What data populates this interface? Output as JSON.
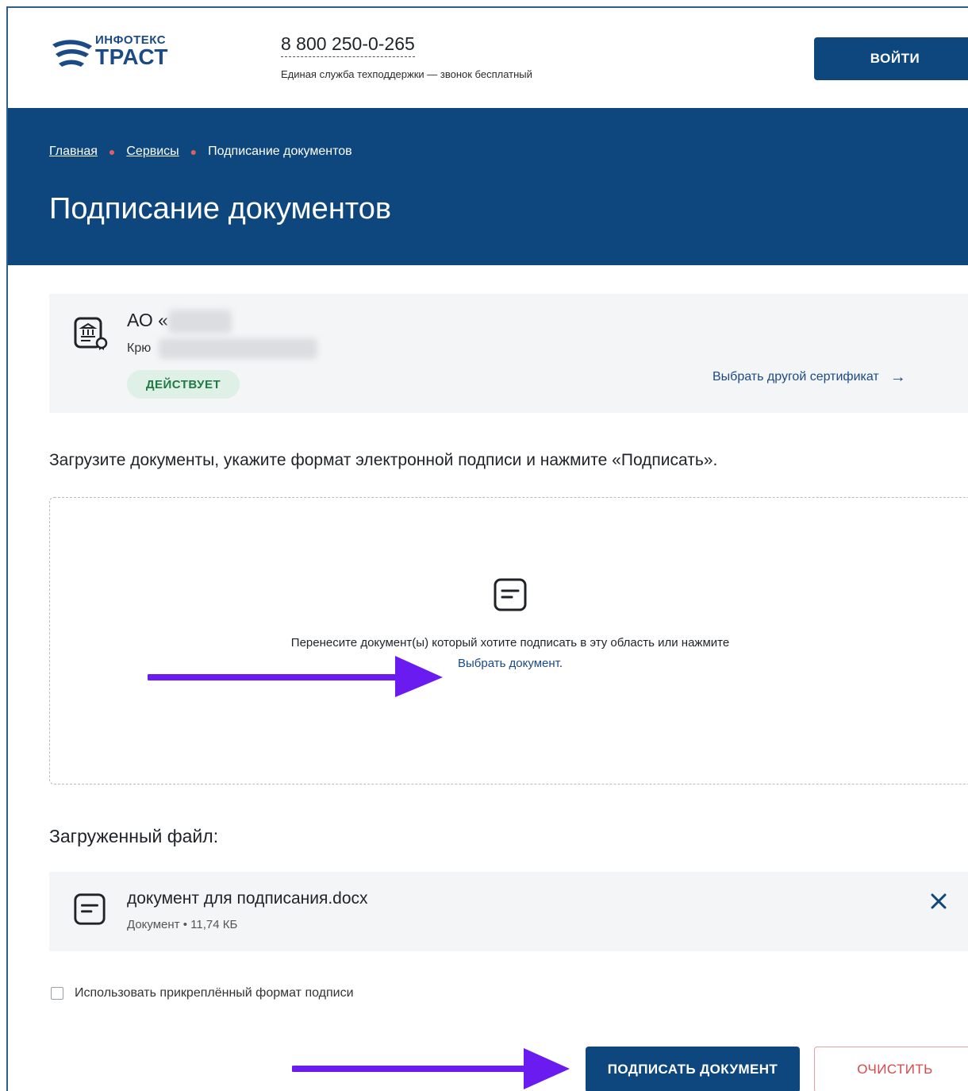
{
  "header": {
    "logo_top": "ИНФОТЕКС",
    "logo_main": "ТРАСТ",
    "phone": "8 800 250-0-265",
    "phone_caption": "Единая служба техподдержки — звонок бесплатный",
    "login_label": "ВОЙТИ"
  },
  "breadcrumb": {
    "items": [
      "Главная",
      "Сервисы"
    ],
    "current": "Подписание документов"
  },
  "page_title": "Подписание документов",
  "certificate": {
    "name": "АО «",
    "owner": "Крю",
    "status": "ДЕЙСТВУЕТ",
    "change_label": "Выбрать другой сертификат",
    "change_arrow": "→"
  },
  "instruction": "Загрузите документы, укажите формат электронной подписи и нажмите «Подписать».",
  "dropzone": {
    "text": "Перенесите документ(ы) который хотите подписать в эту область или нажмите",
    "link": "Выбрать документ",
    "link_suffix": "."
  },
  "uploaded": {
    "title": "Загруженный файл:",
    "file_name": "документ для подписания.docx",
    "file_meta": "Документ • 11,74 КБ"
  },
  "options": {
    "attached_signature_label": "Использовать прикреплённый формат подписи"
  },
  "actions": {
    "sign_label": "ПОДПИСАТЬ ДОКУМЕНТ",
    "clear_label": "ОЧИСТИТЬ"
  },
  "colors": {
    "brand": "#0d477d",
    "status_bg": "#dff0e6",
    "status_text": "#1f7a45",
    "danger": "#d94848",
    "annotation_arrow": "#6a1bf0"
  }
}
